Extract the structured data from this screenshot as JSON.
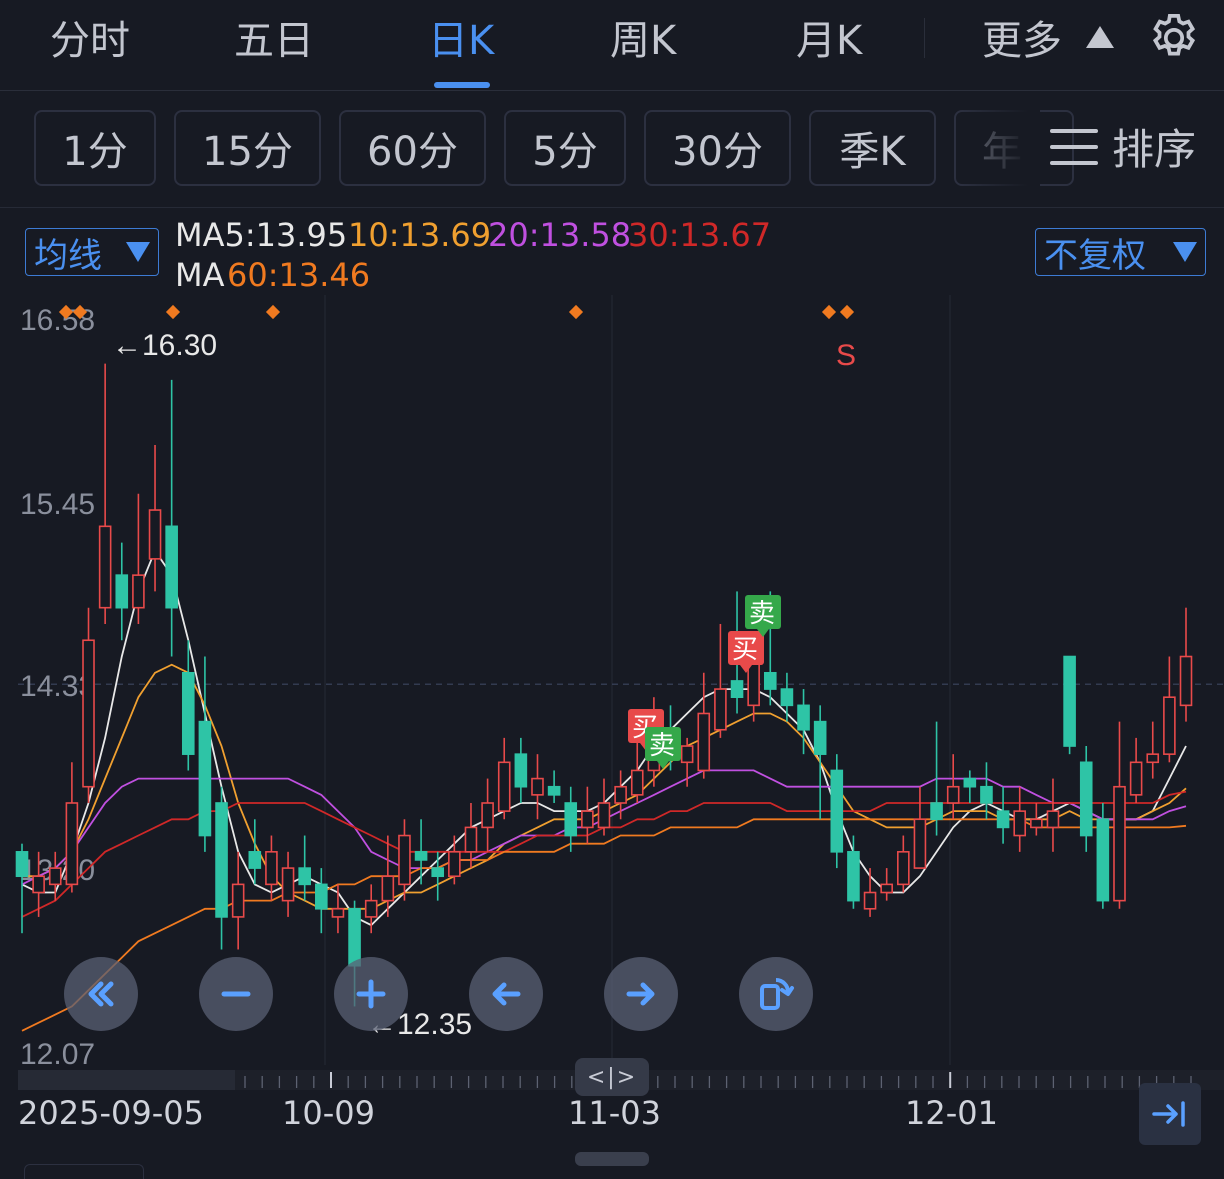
{
  "tabs": {
    "items": [
      {
        "label": "分时",
        "active": false
      },
      {
        "label": "五日",
        "active": false
      },
      {
        "label": "日K",
        "active": true
      },
      {
        "label": "周K",
        "active": false
      },
      {
        "label": "月K",
        "active": false
      }
    ],
    "more_label": "更多"
  },
  "periods": [
    "1分",
    "15分",
    "60分",
    "5分",
    "30分",
    "季K",
    "年"
  ],
  "sort_label": "排序",
  "indicator": {
    "selector_label": "均线",
    "adjust_label": "不复权",
    "ma5": "MA5:13.95",
    "ma10": "10:13.69",
    "ma20": "20:13.58",
    "ma30": "30:13.67",
    "ma60_prefix": "MA",
    "ma60": "60:13.46"
  },
  "colors": {
    "up": "#e84a4a",
    "down": "#2ec4a6",
    "ma5": "#e8e8e8",
    "ma10": "#f0a030",
    "ma20": "#c050e0",
    "ma30": "#d02828",
    "ma60": "#f07a20",
    "accent": "#4a90f0",
    "buy_tag": "#e84a4a",
    "sell_tag": "#35a84a"
  },
  "chart": {
    "y_ticks": [
      "16.58",
      "15.45",
      "14.33",
      "13.20",
      "12.07"
    ],
    "high_label": "←16.30",
    "low_label": "←12.35",
    "signal_s": "S",
    "buy_text": "买",
    "sell_text": "卖",
    "dates": [
      "2025-09-05",
      "10-09",
      "11-03",
      "12-01"
    ]
  },
  "chart_data": {
    "type": "candlestick",
    "ylim": [
      12.07,
      16.58
    ],
    "x_labels": [
      "2025-09-05",
      "10-09",
      "11-03",
      "12-01"
    ],
    "candles": [
      [
        13.3,
        13.15,
        13.35,
        12.8
      ],
      [
        13.05,
        13.15,
        13.3,
        12.9
      ],
      [
        13.1,
        13.2,
        13.3,
        13.0
      ],
      [
        13.1,
        13.6,
        13.85,
        13.05
      ],
      [
        13.7,
        14.6,
        14.8,
        13.6
      ],
      [
        14.8,
        15.3,
        16.3,
        14.7
      ],
      [
        15.0,
        14.8,
        15.2,
        14.6
      ],
      [
        14.8,
        15.0,
        15.5,
        14.7
      ],
      [
        15.1,
        15.4,
        15.8,
        14.9
      ],
      [
        15.3,
        14.8,
        16.2,
        14.5
      ],
      [
        14.4,
        13.9,
        14.6,
        13.8
      ],
      [
        14.1,
        13.4,
        14.5,
        13.3
      ],
      [
        13.6,
        12.9,
        13.7,
        12.7
      ],
      [
        12.9,
        13.1,
        13.3,
        12.7
      ],
      [
        13.3,
        13.2,
        13.5,
        13.1
      ],
      [
        13.1,
        13.3,
        13.4,
        13.0
      ],
      [
        13.0,
        13.2,
        13.3,
        12.9
      ],
      [
        13.2,
        13.1,
        13.4,
        13.0
      ],
      [
        13.1,
        12.95,
        13.2,
        12.8
      ],
      [
        12.9,
        12.95,
        13.1,
        12.8
      ],
      [
        12.95,
        12.6,
        13.0,
        12.35
      ],
      [
        12.9,
        13.0,
        13.1,
        12.8
      ],
      [
        13.0,
        13.15,
        13.4,
        12.9
      ],
      [
        13.1,
        13.4,
        13.5,
        13.0
      ],
      [
        13.3,
        13.25,
        13.5,
        13.1
      ],
      [
        13.2,
        13.15,
        13.3,
        13.0
      ],
      [
        13.15,
        13.3,
        13.4,
        13.1
      ],
      [
        13.3,
        13.45,
        13.6,
        13.2
      ],
      [
        13.45,
        13.6,
        13.75,
        13.3
      ],
      [
        13.55,
        13.85,
        14.0,
        13.5
      ],
      [
        13.9,
        13.7,
        14.0,
        13.6
      ],
      [
        13.65,
        13.75,
        13.9,
        13.5
      ],
      [
        13.7,
        13.65,
        13.8,
        13.6
      ],
      [
        13.6,
        13.4,
        13.7,
        13.3
      ],
      [
        13.45,
        13.55,
        13.7,
        13.35
      ],
      [
        13.45,
        13.6,
        13.75,
        13.4
      ],
      [
        13.6,
        13.7,
        13.8,
        13.5
      ],
      [
        13.65,
        13.8,
        14.0,
        13.6
      ],
      [
        13.8,
        14.1,
        14.25,
        13.7
      ],
      [
        14.05,
        13.9,
        14.2,
        13.8
      ],
      [
        13.85,
        13.95,
        14.0,
        13.7
      ],
      [
        13.8,
        14.15,
        14.4,
        13.75
      ],
      [
        14.05,
        14.3,
        14.7,
        14.0
      ],
      [
        14.35,
        14.25,
        14.9,
        14.15
      ],
      [
        14.2,
        14.5,
        14.6,
        14.1
      ],
      [
        14.4,
        14.3,
        14.9,
        14.2
      ],
      [
        14.3,
        14.2,
        14.4,
        14.1
      ],
      [
        14.2,
        14.05,
        14.3,
        13.9
      ],
      [
        14.1,
        13.9,
        14.2,
        13.5
      ],
      [
        13.8,
        13.3,
        13.9,
        13.2
      ],
      [
        13.3,
        13.0,
        13.4,
        12.95
      ],
      [
        12.95,
        13.05,
        13.2,
        12.9
      ],
      [
        13.05,
        13.1,
        13.2,
        13.0
      ],
      [
        13.1,
        13.3,
        13.4,
        13.05
      ],
      [
        13.2,
        13.5,
        13.7,
        13.2
      ],
      [
        13.6,
        13.5,
        14.1,
        13.4
      ],
      [
        13.6,
        13.7,
        13.9,
        13.5
      ],
      [
        13.75,
        13.7,
        13.8,
        13.6
      ],
      [
        13.7,
        13.6,
        13.85,
        13.5
      ],
      [
        13.55,
        13.45,
        13.7,
        13.35
      ],
      [
        13.4,
        13.55,
        13.7,
        13.3
      ],
      [
        13.45,
        13.5,
        13.6,
        13.4
      ],
      [
        13.45,
        13.55,
        13.75,
        13.3
      ],
      [
        14.5,
        13.95,
        14.5,
        13.9
      ],
      [
        13.85,
        13.4,
        13.95,
        13.3
      ],
      [
        13.5,
        13.0,
        13.6,
        12.95
      ],
      [
        13.0,
        13.7,
        14.1,
        12.95
      ],
      [
        13.65,
        13.85,
        14.0,
        13.6
      ],
      [
        13.85,
        13.9,
        14.1,
        13.75
      ],
      [
        13.9,
        14.25,
        14.5,
        13.85
      ],
      [
        14.2,
        14.5,
        14.8,
        14.1
      ]
    ],
    "series": [
      {
        "name": "MA5",
        "values": [
          13.1,
          13.05,
          13.05,
          13.3,
          13.6,
          14.0,
          14.5,
          14.9,
          15.15,
          15.0,
          14.6,
          14.15,
          13.7,
          13.3,
          13.1,
          13.05,
          13.1,
          13.15,
          13.1,
          13.05,
          12.9,
          12.85,
          12.95,
          13.05,
          13.15,
          13.25,
          13.35,
          13.45,
          13.5,
          13.55,
          13.6,
          13.6,
          13.55,
          13.55,
          13.55,
          13.6,
          13.7,
          13.8,
          13.95,
          14.05,
          14.15,
          14.25,
          14.3,
          14.3,
          14.3,
          14.25,
          14.15,
          14.05,
          13.85,
          13.55,
          13.3,
          13.15,
          13.05,
          13.05,
          13.15,
          13.3,
          13.45,
          13.55,
          13.6,
          13.55,
          13.5,
          13.5,
          13.55,
          13.6,
          13.55,
          13.5,
          13.5,
          13.5,
          13.55,
          13.75,
          13.95
        ]
      },
      {
        "name": "MA10",
        "values": [
          13.15,
          13.15,
          13.2,
          13.3,
          13.5,
          13.75,
          14.0,
          14.25,
          14.4,
          14.45,
          14.4,
          14.2,
          13.95,
          13.6,
          13.35,
          13.15,
          13.05,
          13.0,
          12.95,
          12.95,
          12.95,
          12.95,
          13.0,
          13.05,
          13.05,
          13.1,
          13.15,
          13.2,
          13.25,
          13.35,
          13.4,
          13.45,
          13.5,
          13.5,
          13.5,
          13.55,
          13.6,
          13.65,
          13.75,
          13.85,
          13.95,
          14.0,
          14.05,
          14.1,
          14.15,
          14.15,
          14.1,
          14.0,
          13.85,
          13.7,
          13.55,
          13.5,
          13.45,
          13.45,
          13.45,
          13.5,
          13.55,
          13.55,
          13.55,
          13.5,
          13.5,
          13.5,
          13.5,
          13.55,
          13.5,
          13.5,
          13.5,
          13.5,
          13.55,
          13.6,
          13.69
        ]
      },
      {
        "name": "MA20",
        "values": [
          13.1,
          13.15,
          13.2,
          13.3,
          13.45,
          13.6,
          13.7,
          13.75,
          13.75,
          13.75,
          13.75,
          13.75,
          13.75,
          13.75,
          13.75,
          13.75,
          13.75,
          13.7,
          13.65,
          13.55,
          13.45,
          13.3,
          13.25,
          13.2,
          13.2,
          13.2,
          13.25,
          13.25,
          13.3,
          13.35,
          13.4,
          13.4,
          13.4,
          13.45,
          13.45,
          13.5,
          13.55,
          13.6,
          13.65,
          13.7,
          13.75,
          13.8,
          13.8,
          13.8,
          13.8,
          13.75,
          13.7,
          13.7,
          13.7,
          13.7,
          13.7,
          13.7,
          13.7,
          13.7,
          13.7,
          13.75,
          13.75,
          13.75,
          13.75,
          13.7,
          13.7,
          13.65,
          13.6,
          13.6,
          13.55,
          13.5,
          13.5,
          13.5,
          13.5,
          13.55,
          13.58
        ]
      },
      {
        "name": "MA30",
        "values": [
          12.9,
          12.95,
          13.0,
          13.1,
          13.2,
          13.3,
          13.35,
          13.4,
          13.45,
          13.5,
          13.5,
          13.55,
          13.55,
          13.6,
          13.6,
          13.6,
          13.6,
          13.6,
          13.55,
          13.5,
          13.45,
          13.4,
          13.35,
          13.3,
          13.3,
          13.3,
          13.3,
          13.3,
          13.3,
          13.3,
          13.35,
          13.4,
          13.4,
          13.4,
          13.4,
          13.45,
          13.45,
          13.5,
          13.5,
          13.55,
          13.55,
          13.6,
          13.6,
          13.6,
          13.6,
          13.6,
          13.55,
          13.55,
          13.55,
          13.55,
          13.55,
          13.55,
          13.6,
          13.6,
          13.6,
          13.6,
          13.6,
          13.6,
          13.6,
          13.6,
          13.6,
          13.6,
          13.6,
          13.6,
          13.6,
          13.6,
          13.6,
          13.6,
          13.6,
          13.65,
          13.67
        ]
      },
      {
        "name": "MA60",
        "values": [
          12.2,
          12.25,
          12.3,
          12.35,
          12.45,
          12.55,
          12.65,
          12.75,
          12.8,
          12.85,
          12.9,
          12.95,
          12.95,
          13.0,
          13.0,
          13.0,
          13.05,
          13.05,
          13.05,
          13.1,
          13.1,
          13.15,
          13.15,
          13.15,
          13.2,
          13.2,
          13.25,
          13.25,
          13.25,
          13.3,
          13.3,
          13.3,
          13.3,
          13.35,
          13.35,
          13.35,
          13.4,
          13.4,
          13.4,
          13.45,
          13.45,
          13.45,
          13.45,
          13.45,
          13.5,
          13.5,
          13.5,
          13.5,
          13.5,
          13.5,
          13.5,
          13.5,
          13.5,
          13.5,
          13.5,
          13.5,
          13.5,
          13.5,
          13.5,
          13.5,
          13.5,
          13.45,
          13.45,
          13.45,
          13.45,
          13.45,
          13.45,
          13.45,
          13.45,
          13.45,
          13.46
        ]
      }
    ]
  }
}
